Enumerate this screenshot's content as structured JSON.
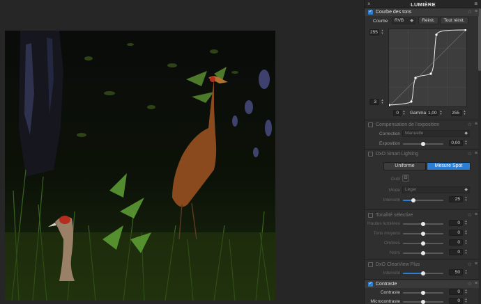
{
  "panel": {
    "title": "LUMIÈRE",
    "close_glyph": "×",
    "menu_glyph": "≡"
  },
  "tone_curve": {
    "title": "Courbe des tons",
    "curve_label": "Courbe",
    "channel": "RVB",
    "reset_label": "Réinit.",
    "reset_all_label": "Tout réinit.",
    "out_max": "255",
    "out_min": "3",
    "in_min": "0",
    "gamma_label": "Gamma",
    "gamma_value": "1,00",
    "in_max": "255"
  },
  "exposure": {
    "title": "Compensation de l'exposition",
    "correction_label": "Correction",
    "correction_value": "Manuelle",
    "exposure_label": "Exposition",
    "exposure_value": "0,00",
    "exposure_level": 0.5
  },
  "smart_lighting": {
    "title": "DxO Smart Lighting",
    "mode_uniform": "Uniforme",
    "mode_spot": "Mesure Spot",
    "tool_label": "Outil",
    "mode_label": "Mode",
    "mode_value": "Léger",
    "intensity_label": "Intensité",
    "intensity_value": "25",
    "intensity_level": 0.25
  },
  "selective_tone": {
    "title": "Tonalité sélective",
    "rows": [
      {
        "label": "Hautes lumières",
        "value": "0",
        "level": 0.5
      },
      {
        "label": "Tons moyens",
        "value": "0",
        "level": 0.5
      },
      {
        "label": "Ombres",
        "value": "0",
        "level": 0.5
      },
      {
        "label": "Noirs",
        "value": "0",
        "level": 0.5
      }
    ]
  },
  "clearview": {
    "title": "DxO ClearView Plus",
    "intensity_label": "Intensité",
    "intensity_value": "50",
    "intensity_level": 0.5
  },
  "contrast": {
    "title": "Contraste",
    "rows": [
      {
        "label": "Contraste",
        "value": "0",
        "level": 0.5
      },
      {
        "label": "Microcontraste",
        "value": "0",
        "level": 0.5
      }
    ]
  },
  "colors": {
    "accent": "#2d7fd3",
    "panel_bg": "#2f2f2f",
    "viewer_bg": "#262626"
  }
}
